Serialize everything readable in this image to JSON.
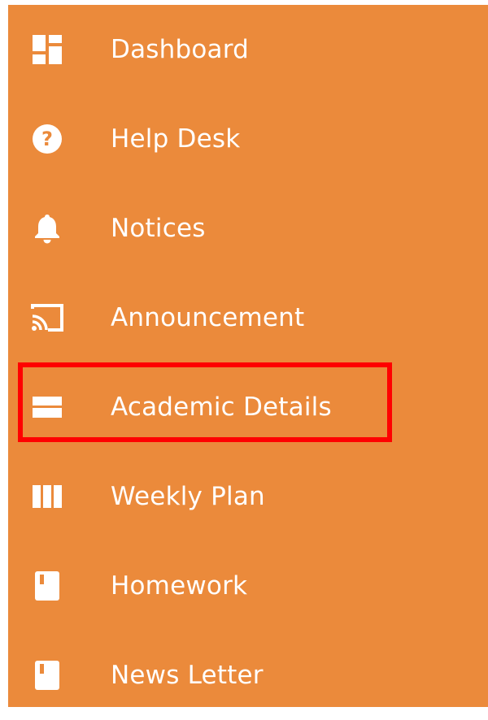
{
  "sidebar": {
    "background": "#EB8A3B",
    "text_color": "#FFFFFF",
    "items": [
      {
        "label": "Dashboard",
        "icon": "dashboard-grid-icon"
      },
      {
        "label": "Help Desk",
        "icon": "question-circle-icon"
      },
      {
        "label": "Notices",
        "icon": "bell-icon"
      },
      {
        "label": "Announcement",
        "icon": "cast-icon"
      },
      {
        "label": "Academic Details",
        "icon": "card-icon",
        "highlighted": true
      },
      {
        "label": "Weekly Plan",
        "icon": "columns-icon"
      },
      {
        "label": "Homework",
        "icon": "book-icon"
      },
      {
        "label": "News Letter",
        "icon": "book-icon"
      }
    ]
  },
  "highlight": {
    "color": "#FF0000",
    "target": "Academic Details"
  }
}
